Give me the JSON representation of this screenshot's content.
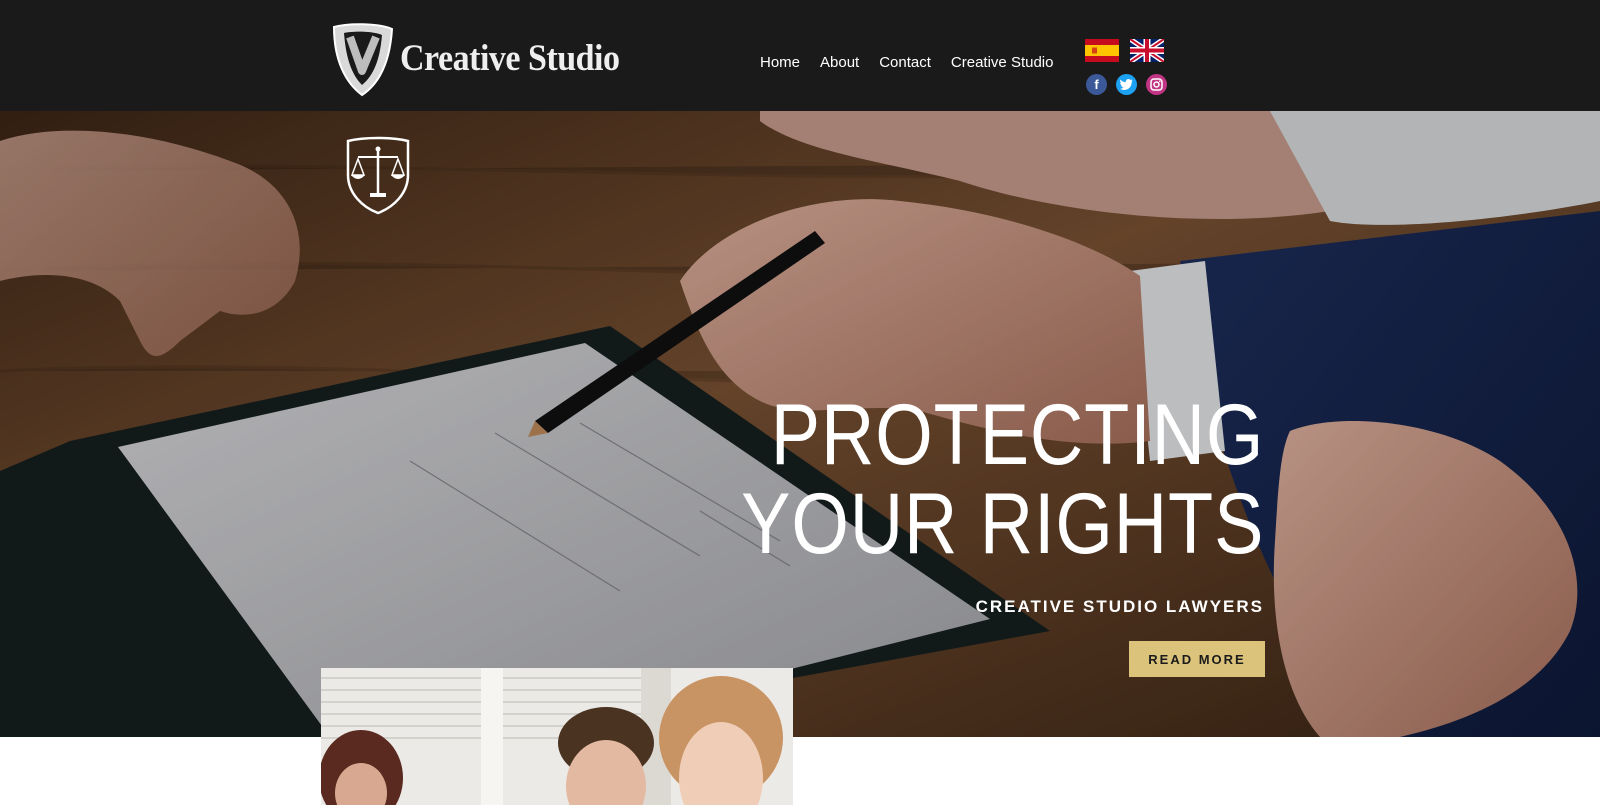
{
  "brand": {
    "name": "Creative Studio"
  },
  "nav": {
    "items": [
      "Home",
      "About",
      "Contact",
      "Creative Studio"
    ]
  },
  "languages": [
    "es-flag-icon",
    "uk-flag-icon"
  ],
  "social": [
    {
      "icon": "facebook-icon",
      "color": "#3b5998"
    },
    {
      "icon": "twitter-icon",
      "color": "#1da1f2"
    },
    {
      "icon": "instagram-icon",
      "color": "#c13584"
    }
  ],
  "hero": {
    "title_line1": "PROTECTING",
    "title_line2": "YOUR RIGHTS",
    "subtitle": "CREATIVE STUDIO LAWYERS",
    "cta_label": "READ MORE"
  },
  "colors": {
    "header_bg": "#1b1a1a",
    "accent": "#dcc37c",
    "text_light": "#ffffff"
  }
}
